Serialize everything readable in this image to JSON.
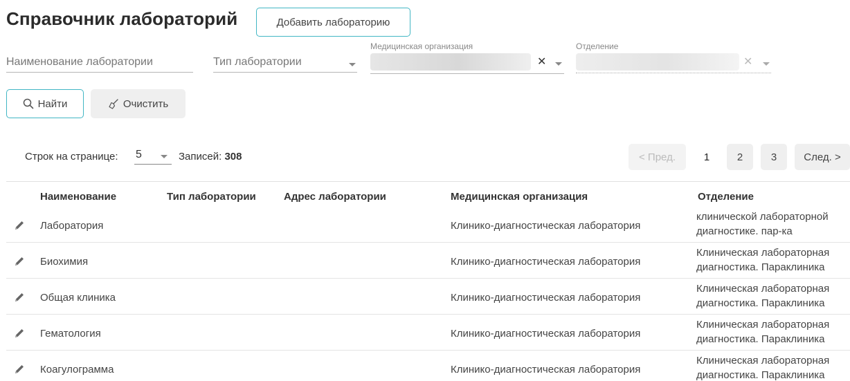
{
  "header": {
    "title": "Справочник лабораторий",
    "add_button": "Добавить лабораторию"
  },
  "filters": {
    "name_placeholder": "Наименование лаборатории",
    "type_placeholder": "Тип лаборатории",
    "med_org_label": "Медицинская организация",
    "department_label": "Отделение"
  },
  "actions": {
    "find": "Найти",
    "clear": "Очистить"
  },
  "pagination": {
    "rows_label": "Строк на странице:",
    "rows_value": "5",
    "records_label": "Записей:",
    "records_count": "308",
    "prev": "< Пред.",
    "pages": [
      "1",
      "2",
      "3"
    ],
    "current_page": "1",
    "next": "След. >"
  },
  "table": {
    "columns": [
      "Наименование",
      "Тип лаборатории",
      "Адрес лаборатории",
      "Медицинская организация",
      "Отделение"
    ],
    "rows": [
      {
        "name": "Лаборатория",
        "type": "",
        "address": "",
        "org": "Клинико-диагностическая лаборатория",
        "dept_line1": "клинической лабораторной",
        "dept_line2": "диагностике. пар-ка"
      },
      {
        "name": "Биохимия",
        "type": "",
        "address": "",
        "org": "Клинико-диагностическая лаборатория",
        "dept_line1": "Клиническая лабораторная",
        "dept_line2": "диагностика. Параклиника"
      },
      {
        "name": "Общая клиника",
        "type": "",
        "address": "",
        "org": "Клинико-диагностическая лаборатория",
        "dept_line1": "Клиническая лабораторная",
        "dept_line2": "диагностика. Параклиника"
      },
      {
        "name": "Гематология",
        "type": "",
        "address": "",
        "org": "Клинико-диагностическая лаборатория",
        "dept_line1": "Клиническая лабораторная",
        "dept_line2": "диагностика. Параклиника"
      },
      {
        "name": "Коагулограмма",
        "type": "",
        "address": "",
        "org": "Клинико-диагностическая лаборатория",
        "dept_line1": "Клиническая лабораторная",
        "dept_line2": "диагностика. Параклиника"
      }
    ]
  },
  "colors": {
    "accent": "#41b6c4",
    "button_gray": "#efefef"
  },
  "icons": {
    "find": "search-icon",
    "clear": "broom-icon",
    "row_edit": "pencil-icon"
  }
}
